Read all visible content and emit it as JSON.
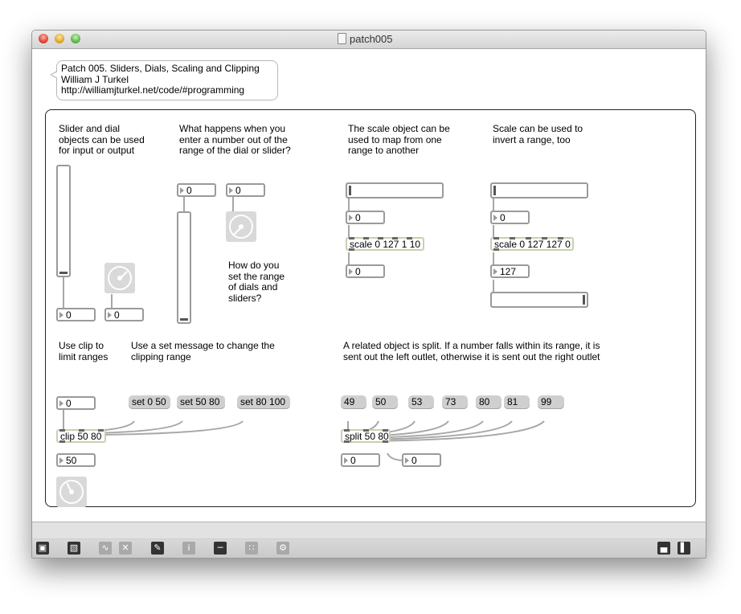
{
  "window": {
    "title": "patch005"
  },
  "header_comment": {
    "lines": "Patch 005. Sliders, Dials, Scaling and Clipping\nWilliam J Turkel\nhttp://williamjturkel.net/code/#programming"
  },
  "comments": {
    "slider_dial": "Slider and dial\nobjects can be used\nfor input or output",
    "out_of_range": "What happens when you\nenter a number out of the\nrange of the dial or slider?",
    "set_range": "How do you\nset the range\nof dials and\nsliders?",
    "scale_map": "The scale object can be\nused to map from one\nrange to another",
    "scale_invert": "Scale can be used to\ninvert a range, too",
    "clip": "Use clip to\nlimit ranges",
    "set_message": "Use a set message to change the\nclipping range",
    "split": "A related object is split. If a number falls within its range, it is\nsent out the left outlet, otherwise it is sent out the right outlet"
  },
  "numbers": {
    "n1": "0",
    "n2": "0",
    "n3": "0",
    "n4": "0",
    "n5": "0",
    "n6": "0",
    "n7": "0",
    "n8": "127",
    "n9": "0",
    "n10": "50",
    "n11": "0",
    "n12": "0"
  },
  "objects": {
    "scale1": "scale 0 127 1 10",
    "scale2": "scale 0 127 127 0",
    "clip": "clip 50 80",
    "split": "split 50 80"
  },
  "messages": {
    "set1": "set 0 50",
    "set2": "set 50 80",
    "set3": "set 80 100",
    "m49": "49",
    "m50": "50",
    "m53": "53",
    "m73": "73",
    "m80": "80",
    "m81": "81",
    "m99": "99"
  },
  "icons": [
    "lock-icon",
    "presentation-icon",
    "patch-cords-icon",
    "clear-icon",
    "edit-mode-icon",
    "inspector-icon",
    "object-icon",
    "grid-icon",
    "snapshot-icon",
    "split-left-icon",
    "split-right-icon"
  ]
}
